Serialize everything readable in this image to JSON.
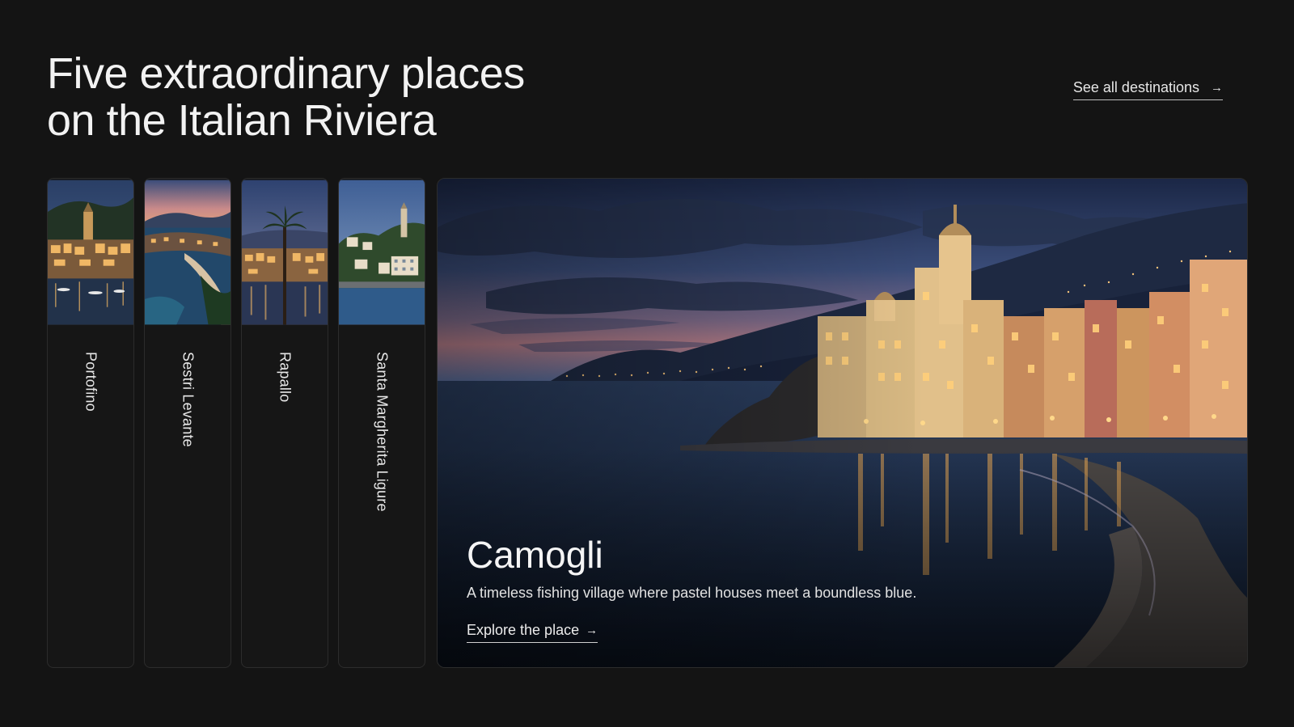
{
  "header": {
    "title_line1": "Five extraordinary places",
    "title_line2": "on the Italian Riviera",
    "see_all_label": "See all destinations",
    "see_all_icon": "arrow-right-icon"
  },
  "destinations": [
    {
      "label": "Portofino"
    },
    {
      "label": "Sestri Levante"
    },
    {
      "label": "Rapallo"
    },
    {
      "label": "Santa Margherita Ligure"
    }
  ],
  "featured": {
    "title": "Camogli",
    "description": "A timeless fishing village where pastel houses meet a boundless blue.",
    "link_label": "Explore the place",
    "link_icon": "arrow-right-icon"
  },
  "arrow_glyph": "→",
  "colors": {
    "background": "#141414",
    "text": "#f2f2f2",
    "night_sky": "#1d2a45",
    "sea": "#1c2c44",
    "lights": "#f3b25a"
  }
}
